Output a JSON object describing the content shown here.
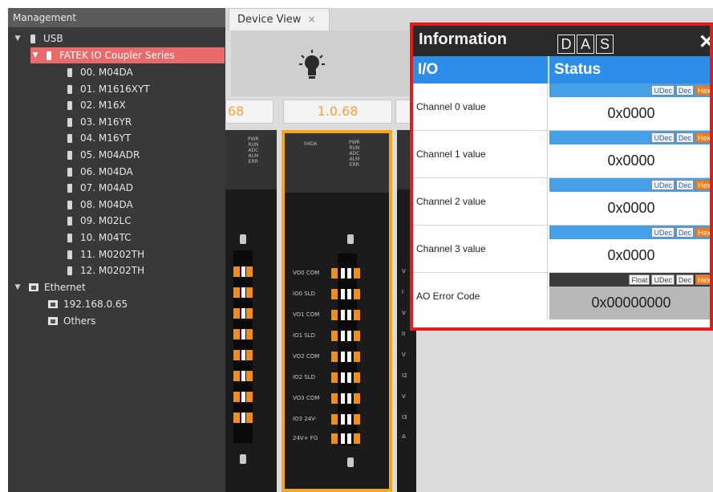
{
  "management": {
    "title": "Management",
    "usb": {
      "label": "USB"
    },
    "series": {
      "label": "FATEK IO Coupler Series"
    },
    "devices": [
      "00. M04DA",
      "01. M1616XYT",
      "02. M16X",
      "03. M16YR",
      "04. M16YT",
      "05. M04ADR",
      "06. M04DA",
      "07. M04AD",
      "08. M04DA",
      "09. M02LC",
      "10. M04TC",
      "11. M0202TH",
      "12. M0202TH"
    ],
    "ethernet": {
      "label": "Ethernet",
      "items": [
        "192.168.0.65",
        "Others"
      ]
    }
  },
  "tab": {
    "label": "Device View",
    "close": "×"
  },
  "device_view": {
    "versions": [
      "68",
      "1.0.68"
    ],
    "module_model": "04DA",
    "led_labels": [
      "PWR",
      "RUN",
      "ADC",
      "ALM",
      "ERR"
    ],
    "terminal_labels": [
      "VO0 COM",
      "IO0 SLD",
      "VO1 COM",
      "IO1 SLD",
      "VO2 COM",
      "IO2 SLD",
      "VO3 COM",
      "IO3 24V-",
      "24V+ FG"
    ],
    "right_module_letters": [
      "V",
      "I",
      "V",
      "II",
      "V",
      "I2",
      "V",
      "I3",
      "A"
    ]
  },
  "info_panel": {
    "title": "Information",
    "buttons": [
      "D",
      "A",
      "S"
    ],
    "close": "✕",
    "headers": {
      "io": "I/O",
      "status": "Status"
    },
    "rows": [
      {
        "label": "Channel 0 value",
        "formats": [
          "UDec",
          "Dec",
          "Hex"
        ],
        "value": "0x0000"
      },
      {
        "label": "Channel 1 value",
        "formats": [
          "UDec",
          "Dec",
          "Hex"
        ],
        "value": "0x0000"
      },
      {
        "label": "Channel 2 value",
        "formats": [
          "UDec",
          "Dec",
          "Hex"
        ],
        "value": "0x0000"
      },
      {
        "label": "Channel 3 value",
        "formats": [
          "UDec",
          "Dec",
          "Hex"
        ],
        "value": "0x0000"
      },
      {
        "label": "AO Error Code",
        "formats": [
          "Float",
          "UDec",
          "Dec",
          "Hex"
        ],
        "value": "0x00000000"
      }
    ],
    "colors": {
      "border": "#e31b1b",
      "header": "#2d8ee9",
      "active_format": "#f27b1d"
    }
  }
}
